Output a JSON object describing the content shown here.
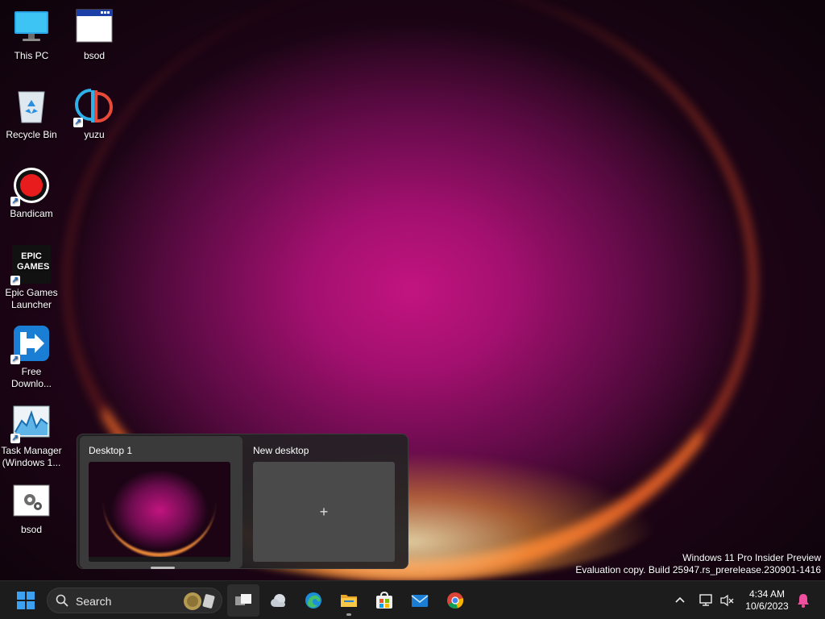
{
  "desktop": {
    "icons": [
      {
        "label": "This PC",
        "icon": "monitor-icon"
      },
      {
        "label": "bsod",
        "icon": "window-icon"
      },
      {
        "label": "Recycle Bin",
        "icon": "recycle-bin-icon"
      },
      {
        "label": "yuzu",
        "icon": "yuzu-icon"
      },
      {
        "label": "Bandicam",
        "icon": "record-icon"
      },
      {
        "label": "Epic Games Launcher",
        "icon": "epic-games-icon",
        "logo_text": "EPIC GAMES"
      },
      {
        "label": "Free Downlo...",
        "icon": "download-manager-icon"
      },
      {
        "label": "Task Manager (Windows 1...",
        "icon": "task-manager-icon"
      },
      {
        "label": "bsod",
        "icon": "settings-window-icon"
      }
    ]
  },
  "task_view": {
    "desktops": [
      {
        "label": "Desktop 1"
      },
      {
        "label": "New desktop",
        "add_symbol": "+"
      }
    ]
  },
  "watermark": {
    "line1": "Windows 11 Pro Insider Preview",
    "line2": "Evaluation copy. Build 25947.rs_prerelease.230901-1416"
  },
  "taskbar": {
    "search_placeholder": "Search",
    "apps": [
      "task-view",
      "weather",
      "edge",
      "file-explorer",
      "microsoft-store",
      "mail",
      "chrome"
    ],
    "clock": {
      "time": "4:34 AM",
      "date": "10/6/2023"
    }
  },
  "colors": {
    "accent": "#0078d4",
    "taskbar_bg": "#1c1c1c",
    "flyout_bg": "#242224"
  }
}
